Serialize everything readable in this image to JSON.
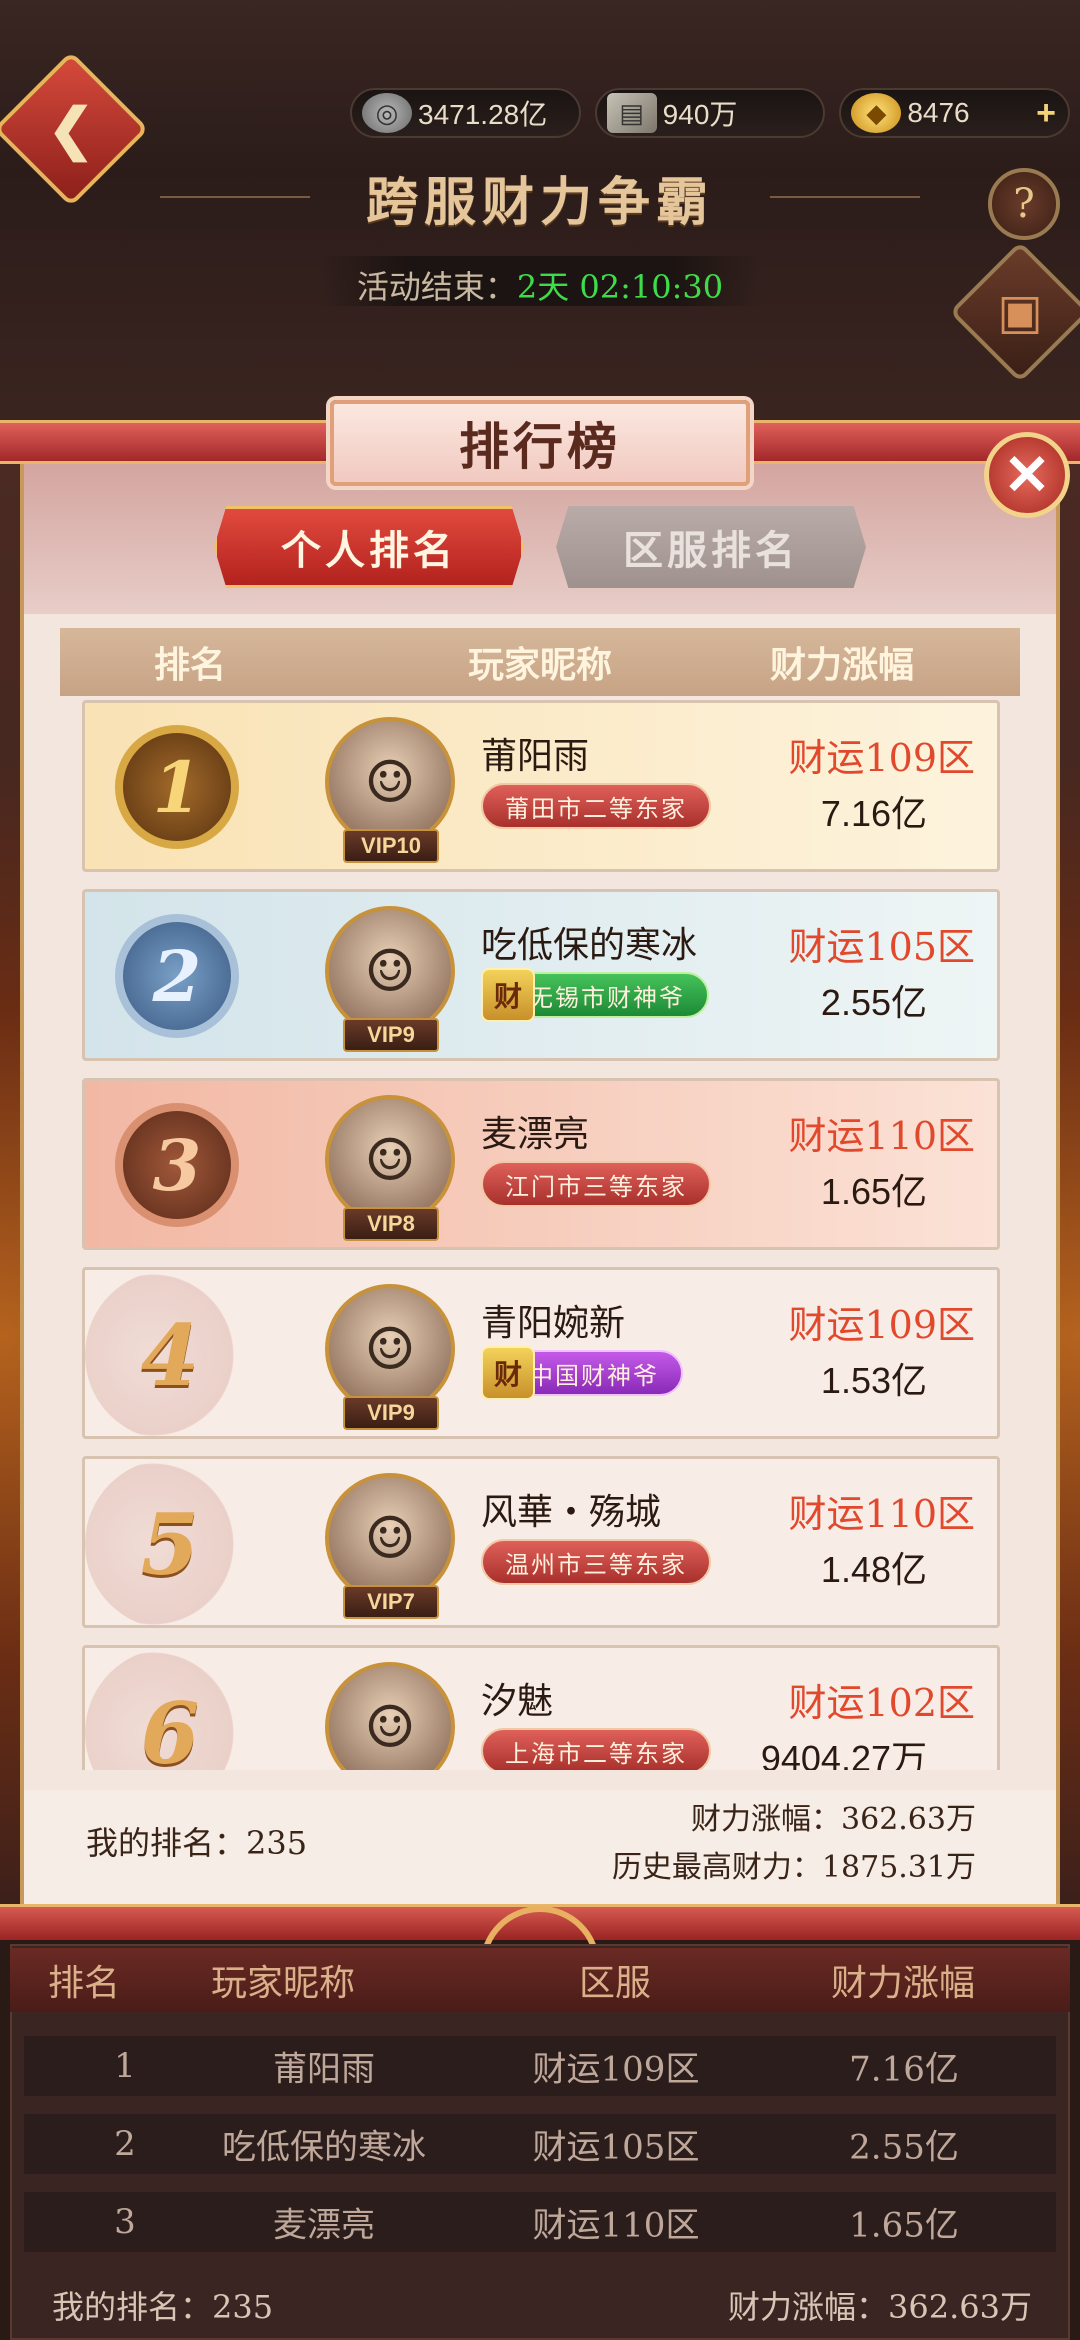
{
  "resources": [
    {
      "icon": "silver-coin-icon",
      "value": "3471.28亿"
    },
    {
      "icon": "scroll-icon",
      "value": "940万"
    },
    {
      "icon": "gold-ingot-icon",
      "value": "8476"
    }
  ],
  "header": {
    "title": "跨服财力争霸",
    "timer_label": "活动结束：",
    "timer_value": "2天 02:10:30"
  },
  "panel": {
    "title": "排行榜",
    "tabs": [
      {
        "label": "个人排名",
        "active": true
      },
      {
        "label": "区服排名",
        "active": false
      }
    ],
    "columns": [
      "排名",
      "玩家昵称",
      "财力涨幅"
    ],
    "rows": [
      {
        "rank": "1",
        "name": "莆阳雨",
        "vip": "VIP10",
        "title": "莆田市二等东家",
        "title_style": "red",
        "server": "财运109区",
        "wealth": "7.16亿"
      },
      {
        "rank": "2",
        "name": "吃低保的寒冰",
        "vip": "VIP9",
        "title": "无锡市财神爷",
        "title_style": "green",
        "server": "财运105区",
        "wealth": "2.55亿"
      },
      {
        "rank": "3",
        "name": "麦漂亮",
        "vip": "VIP8",
        "title": "江门市三等东家",
        "title_style": "red",
        "server": "财运110区",
        "wealth": "1.65亿"
      },
      {
        "rank": "4",
        "name": "青阳婉新",
        "vip": "VIP9",
        "title": "中国财神爷",
        "title_style": "purple",
        "server": "财运109区",
        "wealth": "1.53亿"
      },
      {
        "rank": "5",
        "name": "风華・殇城",
        "vip": "VIP7",
        "title": "温州市三等东家",
        "title_style": "red",
        "server": "财运110区",
        "wealth": "1.48亿"
      },
      {
        "rank": "6",
        "name": "汐魅",
        "vip": "",
        "title": "上海市二等东家",
        "title_style": "red",
        "server": "财运102区",
        "wealth": "9404.27万"
      }
    ],
    "cai_badge": "财",
    "my_rank": "我的排名：235",
    "my_gain": "财力涨幅：362.63万",
    "my_history": "历史最高财力：1875.31万"
  },
  "lower_table": {
    "columns": [
      "排名",
      "玩家昵称",
      "区服",
      "财力涨幅"
    ],
    "rows": [
      {
        "rank": "1",
        "name": "莆阳雨",
        "server": "财运109区",
        "wealth": "7.16亿"
      },
      {
        "rank": "2",
        "name": "吃低保的寒冰",
        "server": "财运105区",
        "wealth": "2.55亿"
      },
      {
        "rank": "3",
        "name": "麦漂亮",
        "server": "财运110区",
        "wealth": "1.65亿"
      }
    ],
    "my_rank": "我的排名：235",
    "my_gain": "财力涨幅：362.63万"
  }
}
